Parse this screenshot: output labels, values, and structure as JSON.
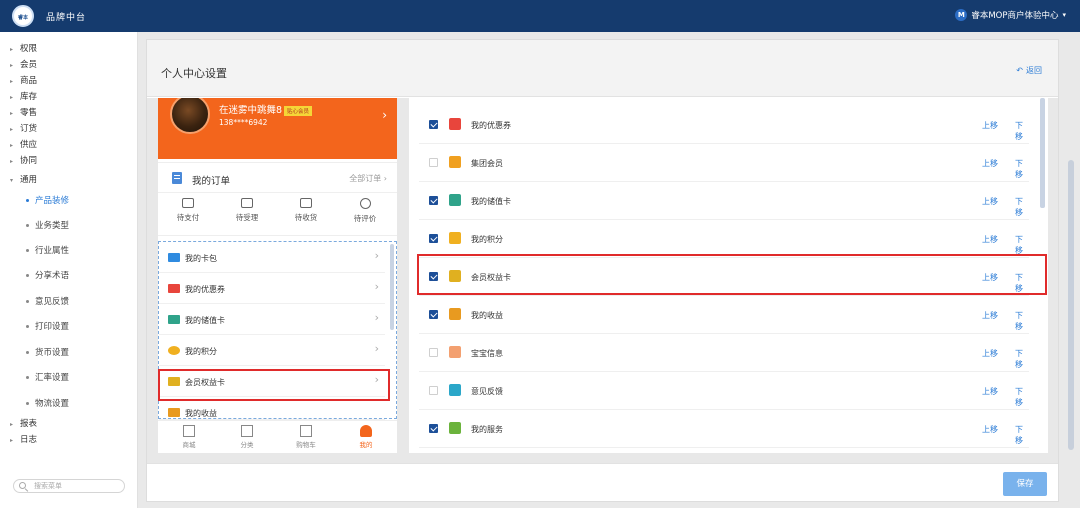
{
  "topbar": {
    "logo_text": "睿本",
    "brand": "品牌中台",
    "account_badge": "M",
    "account": "睿本MOP商户体验中心"
  },
  "sidebar": {
    "groups_before": [
      "权限",
      "会员",
      "商品",
      "库存",
      "零售",
      "订货",
      "供应",
      "协同",
      "通用"
    ],
    "sub_items": [
      "产品装修",
      "业务类型",
      "行业属性",
      "分享术语",
      "意见反馈",
      "打印设置",
      "货币设置",
      "汇率设置",
      "物流设置"
    ],
    "groups_after": [
      "报表",
      "日志"
    ],
    "search_placeholder": "搜索菜单"
  },
  "page": {
    "title": "个人中心设置",
    "back": "返回",
    "save": "保存"
  },
  "preview": {
    "user_name": "在迷雾中跳舞8",
    "vip_label": "贴心会员",
    "phone": "138****6942",
    "orders_title": "我的订单",
    "orders_all": "全部订单",
    "order_steps": [
      "待支付",
      "待受理",
      "待收货",
      "待评价"
    ],
    "menu": [
      "我的卡包",
      "我的优惠券",
      "我的储值卡",
      "我的积分",
      "会员权益卡",
      "我的收益"
    ],
    "tabs": [
      "商城",
      "分类",
      "购物车",
      "我的"
    ]
  },
  "config": {
    "move_up": "上移",
    "move_down": "下移",
    "rows": [
      {
        "label": "我的优惠券",
        "checked": true,
        "icon_color": "#e8453c"
      },
      {
        "label": "集团会员",
        "checked": false,
        "icon_color": "#f0a020"
      },
      {
        "label": "我的储值卡",
        "checked": true,
        "icon_color": "#2fa38a"
      },
      {
        "label": "我的积分",
        "checked": true,
        "icon_color": "#f0b020"
      },
      {
        "label": "会员权益卡",
        "checked": true,
        "icon_color": "#e0b020"
      },
      {
        "label": "我的收益",
        "checked": true,
        "icon_color": "#e89a20"
      },
      {
        "label": "宝宝信息",
        "checked": false,
        "icon_color": "#f3a070"
      },
      {
        "label": "意见反馈",
        "checked": false,
        "icon_color": "#2ba7c9"
      },
      {
        "label": "我的服务",
        "checked": true,
        "icon_color": "#6bb33c"
      }
    ]
  },
  "colors": {
    "topbar": "#153b6e",
    "profile_orange": "#f3651c",
    "link_blue": "#2a7bd6",
    "highlight_red": "#e02b2b",
    "save_button": "#79b2ec"
  }
}
